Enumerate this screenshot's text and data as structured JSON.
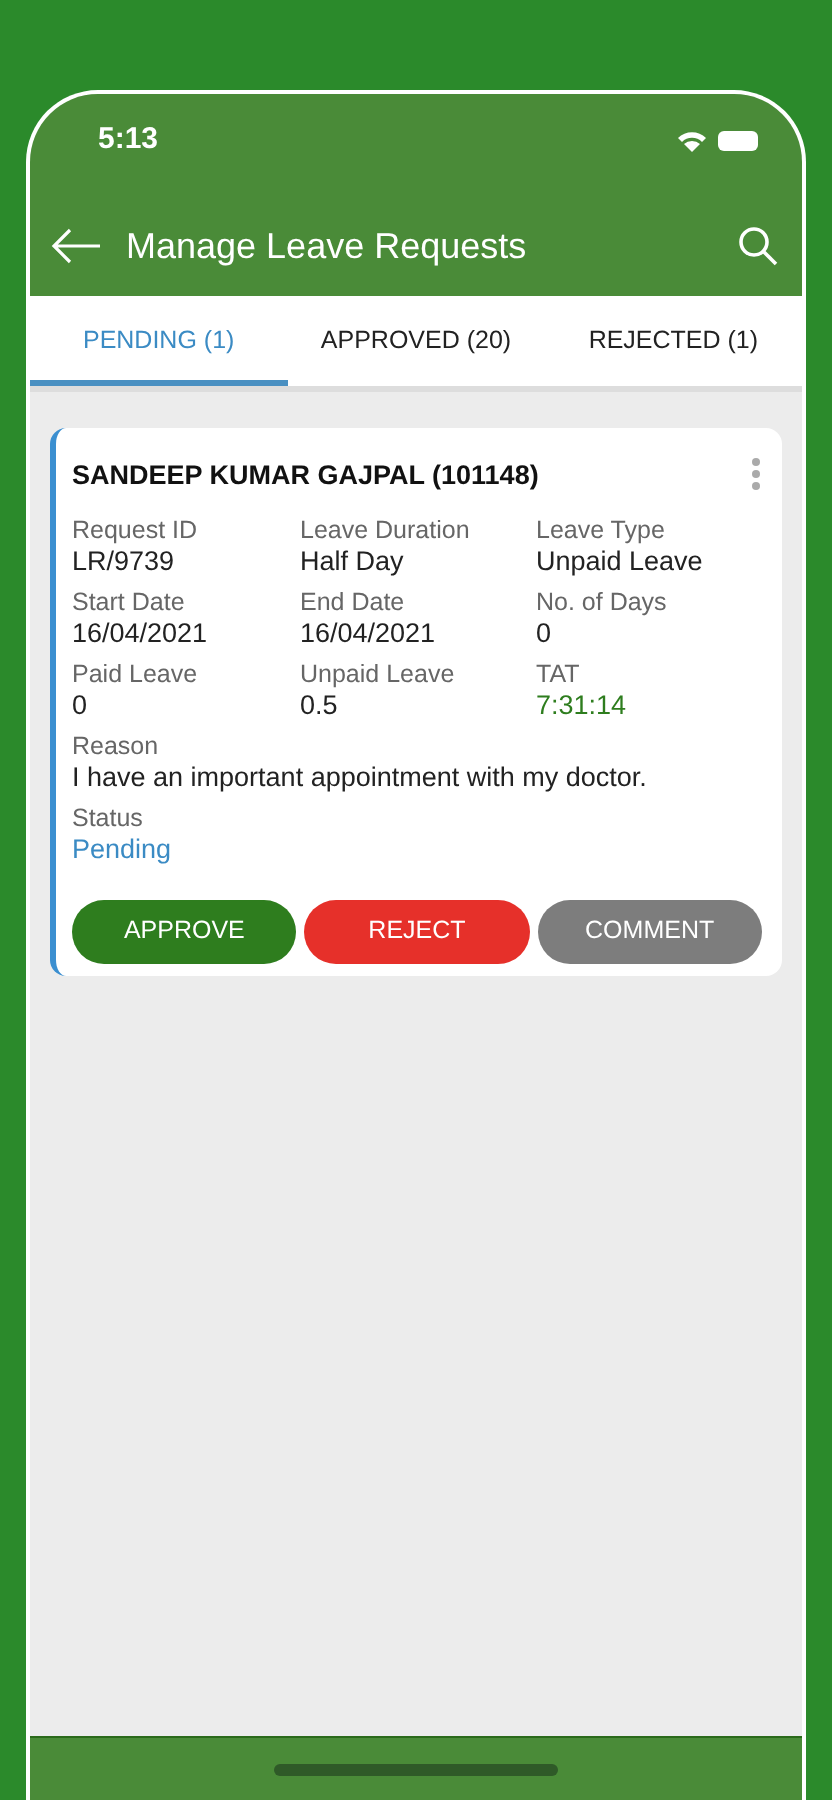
{
  "status_bar": {
    "time": "5:13"
  },
  "app_bar": {
    "title": "Manage Leave Requests"
  },
  "tabs": [
    {
      "label": "PENDING (1)",
      "selected": true
    },
    {
      "label": "APPROVED (20)",
      "selected": false
    },
    {
      "label": "REJECTED (1)",
      "selected": false
    }
  ],
  "request": {
    "employee": "SANDEEP KUMAR GAJPAL (101148)",
    "fields": [
      {
        "label": "Request ID",
        "value": "LR/9739",
        "kind": "plain"
      },
      {
        "label": "Leave Duration",
        "value": "Half Day",
        "kind": "plain"
      },
      {
        "label": "Leave Type",
        "value": "Unpaid Leave",
        "kind": "plain"
      },
      {
        "label": "Start Date",
        "value": "16/04/2021",
        "kind": "plain"
      },
      {
        "label": "End Date",
        "value": "16/04/2021",
        "kind": "plain"
      },
      {
        "label": "No. of Days",
        "value": "0",
        "kind": "plain"
      },
      {
        "label": "Paid Leave",
        "value": "0",
        "kind": "plain"
      },
      {
        "label": "Unpaid Leave",
        "value": "0.5",
        "kind": "plain"
      },
      {
        "label": "TAT",
        "value": "7:31:14",
        "kind": "timer"
      }
    ],
    "reason": {
      "label": "Reason",
      "value": "I have an important appointment with my doctor."
    },
    "status": {
      "label": "Status",
      "value": "Pending"
    },
    "actions": [
      {
        "label": "APPROVE",
        "kind": "approve"
      },
      {
        "label": "REJECT",
        "kind": "reject"
      },
      {
        "label": "COMMENT",
        "kind": "comment"
      }
    ]
  }
}
